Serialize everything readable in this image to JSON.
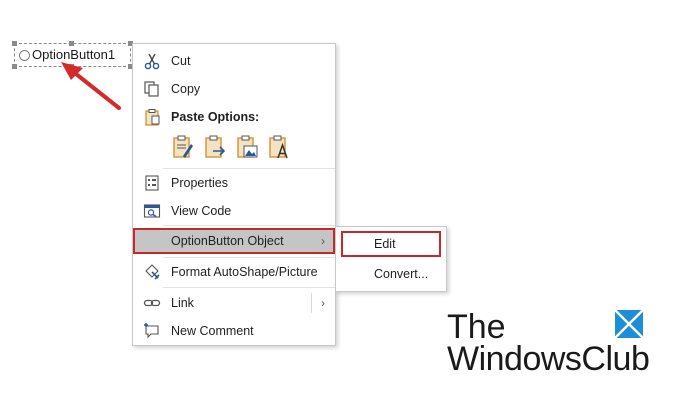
{
  "control": {
    "label": "OptionButton1"
  },
  "menu": {
    "cut": "Cut",
    "copy": "Copy",
    "paste_options": "Paste Options:",
    "properties": "Properties",
    "view_code": "View Code",
    "optionbutton_object": "OptionButton Object",
    "format_autoshape": "Format AutoShape/Picture",
    "link": "Link",
    "new_comment": "New Comment"
  },
  "submenu": {
    "edit": "Edit",
    "convert": "Convert..."
  },
  "watermark": {
    "line1": "The",
    "line2": "WindowsClub"
  },
  "colors": {
    "highlight_border": "#c8282c",
    "hover_bg": "#c5c5c5",
    "icon_blue": "#2b579a",
    "clipboard_orange": "#d18b2c"
  }
}
